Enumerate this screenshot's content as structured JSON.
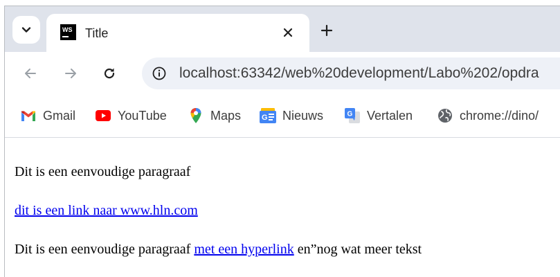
{
  "browser": {
    "tab": {
      "title": "Title",
      "favicon_text": "WS"
    },
    "address_bar": {
      "url": "localhost:63342/web%20development/Labo%202/opdra"
    },
    "bookmarks": [
      {
        "label": "Gmail",
        "icon": "gmail-icon"
      },
      {
        "label": "YouTube",
        "icon": "youtube-icon"
      },
      {
        "label": "Maps",
        "icon": "maps-pin-icon"
      },
      {
        "label": "Nieuws",
        "icon": "google-news-icon"
      },
      {
        "label": "Vertalen",
        "icon": "google-translate-icon"
      },
      {
        "label": "chrome://dino/",
        "icon": "globe-icon"
      }
    ],
    "colors": {
      "tabstrip": "#dfe3eb",
      "omnibox": "#eef1f7",
      "link": "#0000ee"
    }
  },
  "page": {
    "paragraph1": "Dit is een eenvoudige paragraaf",
    "link1": "dit is een link naar www.hln.com",
    "paragraph3_start": "Dit is een eenvoudige paragraaf ",
    "paragraph3_link": "met een hyperlink",
    "paragraph3_end": " en”nog wat meer tekst"
  }
}
